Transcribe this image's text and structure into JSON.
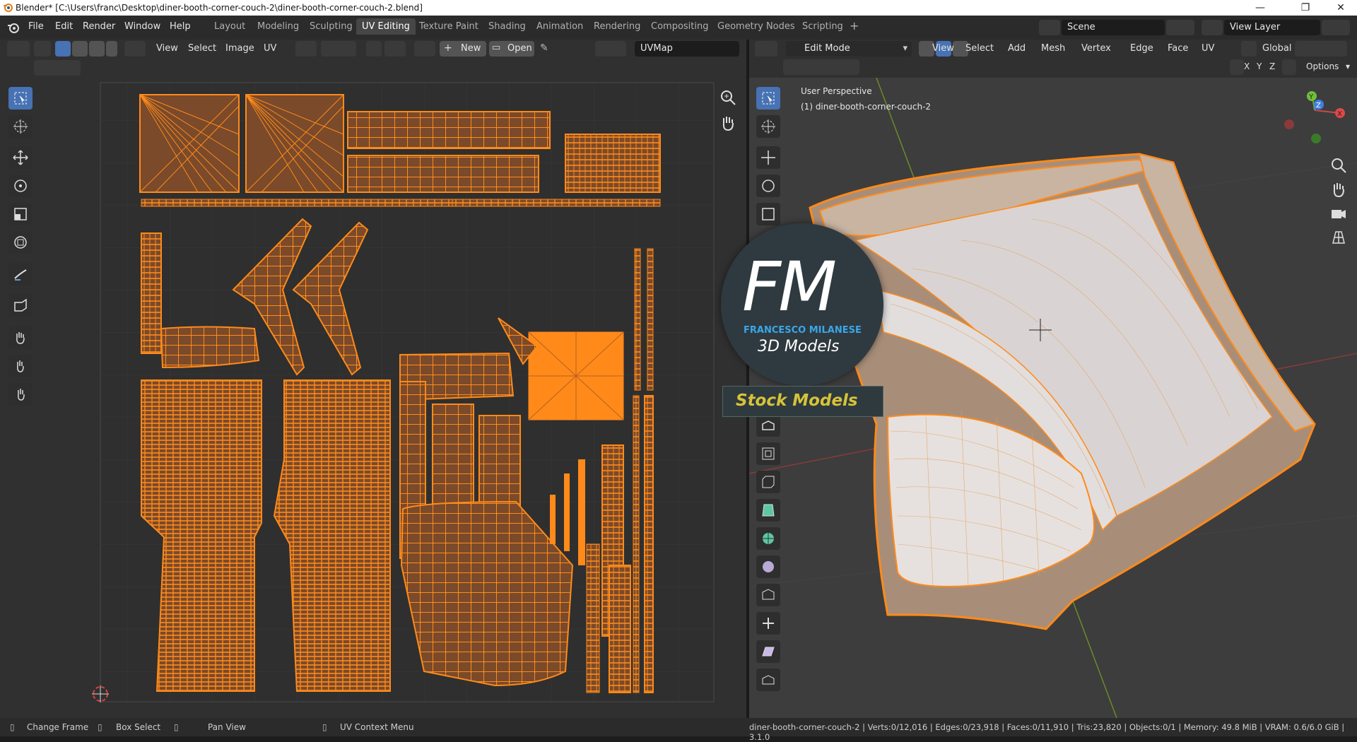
{
  "window": {
    "title": "Blender* [C:\\Users\\franc\\Desktop\\diner-booth-corner-couch-2\\diner-booth-corner-couch-2.blend]",
    "minimize": "—",
    "maximize": "❐",
    "close": "✕"
  },
  "menus": [
    "File",
    "Edit",
    "Render",
    "Window",
    "Help"
  ],
  "workspaces": [
    "Layout",
    "Modeling",
    "Sculpting",
    "UV Editing",
    "Texture Paint",
    "Shading",
    "Animation",
    "Rendering",
    "Compositing",
    "Geometry Nodes",
    "Scripting"
  ],
  "active_workspace": "UV Editing",
  "add_workspace": "+",
  "scene": {
    "label": "Scene"
  },
  "view_layer": {
    "label": "View Layer"
  },
  "uv_editor": {
    "menus": [
      "View",
      "Select",
      "Image",
      "UV"
    ],
    "new_label": "New",
    "open_label": "Open",
    "uvmap": "UVMap"
  },
  "viewport": {
    "mode": "Edit Mode",
    "menus": [
      "View",
      "Select",
      "Add",
      "Mesh",
      "Vertex",
      "Edge",
      "Face",
      "UV"
    ],
    "transform": "Global",
    "axes": [
      "X",
      "Y",
      "Z"
    ],
    "options": "Options",
    "overlay_line1": "User Perspective",
    "overlay_line2": "(1) diner-booth-corner-couch-2"
  },
  "watermark": {
    "letters": "FM",
    "name": "FRANCESCO MILANESE",
    "subtitle": "3D Models",
    "banner": "Stock Models"
  },
  "status": {
    "change_frame": "Change Frame",
    "box_select": "Box Select",
    "pan_view": "Pan View",
    "context_menu": "UV Context Menu",
    "stats": "diner-booth-corner-couch-2 | Verts:0/12,016 | Edges:0/23,918 | Faces:0/11,910 | Tris:23,820 | Objects:0/1 | Memory: 49.8 MiB | VRAM: 0.6/6.0 GiB | 3.1.0"
  },
  "colors": {
    "accent": "#4772b3",
    "uv_orange": "#ff8a1a",
    "uv_fill": "#7a4a2a",
    "header": "#303030",
    "editor_bg": "#303030"
  }
}
